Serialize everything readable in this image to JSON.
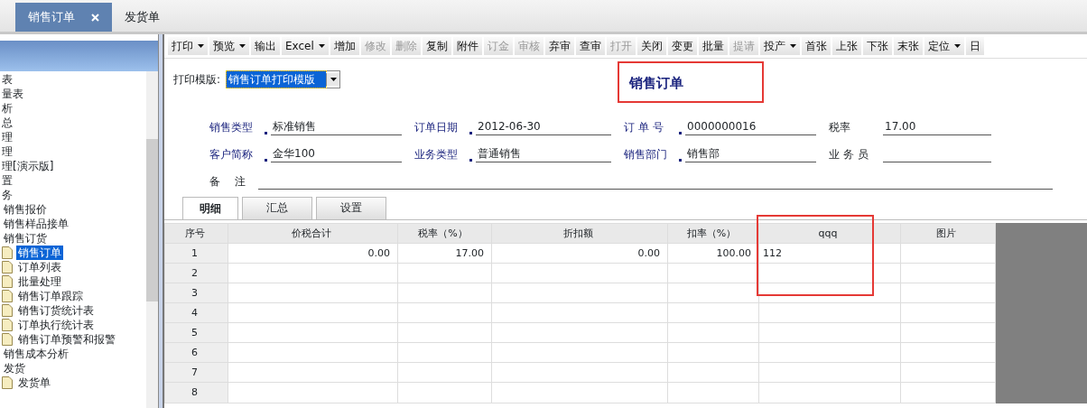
{
  "doc_tabs": [
    {
      "label": "销售订单",
      "selected": true,
      "closable": true
    },
    {
      "label": "发货单",
      "selected": false,
      "closable": false
    }
  ],
  "sidebar": {
    "items": [
      {
        "label": "表"
      },
      {
        "label": "量表"
      },
      {
        "label": "析"
      },
      {
        "label": "总"
      },
      {
        "label": "理"
      },
      {
        "label": "理"
      },
      {
        "label": "理[演示版]"
      },
      {
        "label": "置"
      },
      {
        "label": "务",
        "children": [
          {
            "label": "销售报价"
          },
          {
            "label": "销售样品接单"
          },
          {
            "label": "销售订货",
            "children": [
              {
                "label": "销售订单",
                "selected": true
              },
              {
                "label": "订单列表",
                "selected": false
              },
              {
                "label": "批量处理",
                "selected": false
              },
              {
                "label": "销售订单跟踪",
                "selected": false
              },
              {
                "label": "销售订货统计表",
                "selected": false
              },
              {
                "label": "订单执行统计表",
                "selected": false
              },
              {
                "label": "销售订单预警和报警",
                "selected": false
              }
            ]
          },
          {
            "label": "销售成本分析"
          },
          {
            "label": "发货",
            "children": [
              {
                "label": "发货单",
                "selected": false
              }
            ]
          }
        ]
      }
    ]
  },
  "toolbar": [
    {
      "label": "打印",
      "dropdown": true,
      "disabled": false
    },
    {
      "label": "预览",
      "dropdown": true,
      "disabled": false
    },
    {
      "label": "输出",
      "dropdown": false,
      "disabled": false
    },
    {
      "label": "Excel",
      "dropdown": true,
      "disabled": false
    },
    {
      "label": "增加",
      "dropdown": false,
      "disabled": false
    },
    {
      "label": "修改",
      "dropdown": false,
      "disabled": true
    },
    {
      "label": "删除",
      "dropdown": false,
      "disabled": true
    },
    {
      "label": "复制",
      "dropdown": false,
      "disabled": false
    },
    {
      "label": "附件",
      "dropdown": false,
      "disabled": false
    },
    {
      "label": "订金",
      "dropdown": false,
      "disabled": true
    },
    {
      "label": "审核",
      "dropdown": false,
      "disabled": true
    },
    {
      "label": "弃审",
      "dropdown": false,
      "disabled": false
    },
    {
      "label": "查审",
      "dropdown": false,
      "disabled": false
    },
    {
      "label": "打开",
      "dropdown": false,
      "disabled": true
    },
    {
      "label": "关闭",
      "dropdown": false,
      "disabled": false
    },
    {
      "label": "变更",
      "dropdown": false,
      "disabled": false
    },
    {
      "label": "批量",
      "dropdown": false,
      "disabled": false
    },
    {
      "label": "提请",
      "dropdown": false,
      "disabled": true
    },
    {
      "label": "投产",
      "dropdown": true,
      "disabled": false
    },
    {
      "label": "首张",
      "dropdown": false,
      "disabled": false
    },
    {
      "label": "上张",
      "dropdown": false,
      "disabled": false
    },
    {
      "label": "下张",
      "dropdown": false,
      "disabled": false
    },
    {
      "label": "末张",
      "dropdown": false,
      "disabled": false
    },
    {
      "label": "定位",
      "dropdown": true,
      "disabled": false
    },
    {
      "label": "日",
      "dropdown": false,
      "disabled": false
    }
  ],
  "print_template": {
    "label": "打印模版:",
    "value": "销售订单打印模版"
  },
  "form_title": "销售订单",
  "form_rows": [
    [
      {
        "label": "销售类型",
        "required": true,
        "value": "标准销售"
      },
      {
        "label": "订单日期",
        "required": true,
        "value": "2012-06-30"
      },
      {
        "label": "订 单 号",
        "required": true,
        "value": "0000000016"
      },
      {
        "label": "税率",
        "required": false,
        "value": "17.00"
      }
    ],
    [
      {
        "label": "客户简称",
        "required": true,
        "value": "金华100"
      },
      {
        "label": "业务类型",
        "required": true,
        "value": "普通销售"
      },
      {
        "label": "销售部门",
        "required": true,
        "value": "销售部"
      },
      {
        "label": "业 务 员",
        "required": false
      }
    ],
    [
      {
        "label": "备　 注",
        "required": false
      }
    ]
  ],
  "detail_tabs": [
    {
      "label": "明细",
      "selected": true
    },
    {
      "label": "汇总",
      "selected": false
    },
    {
      "label": "设置",
      "selected": false
    }
  ],
  "table": {
    "columns": [
      "序号",
      "价税合计",
      "税率（%）",
      "折扣额",
      "扣率（%）",
      "qqq",
      "图片"
    ],
    "rows": [
      [
        "1",
        "0.00",
        "17.00",
        "0.00",
        "100.00",
        "112",
        ""
      ],
      [
        "2",
        "",
        "",
        "",
        "",
        "",
        ""
      ],
      [
        "3",
        "",
        "",
        "",
        "",
        "",
        ""
      ],
      [
        "4",
        "",
        "",
        "",
        "",
        "",
        ""
      ],
      [
        "5",
        "",
        "",
        "",
        "",
        "",
        ""
      ],
      [
        "6",
        "",
        "",
        "",
        "",
        "",
        ""
      ],
      [
        "7",
        "",
        "",
        "",
        "",
        "",
        ""
      ],
      [
        "8",
        "",
        "",
        "",
        "",
        "",
        ""
      ]
    ]
  }
}
